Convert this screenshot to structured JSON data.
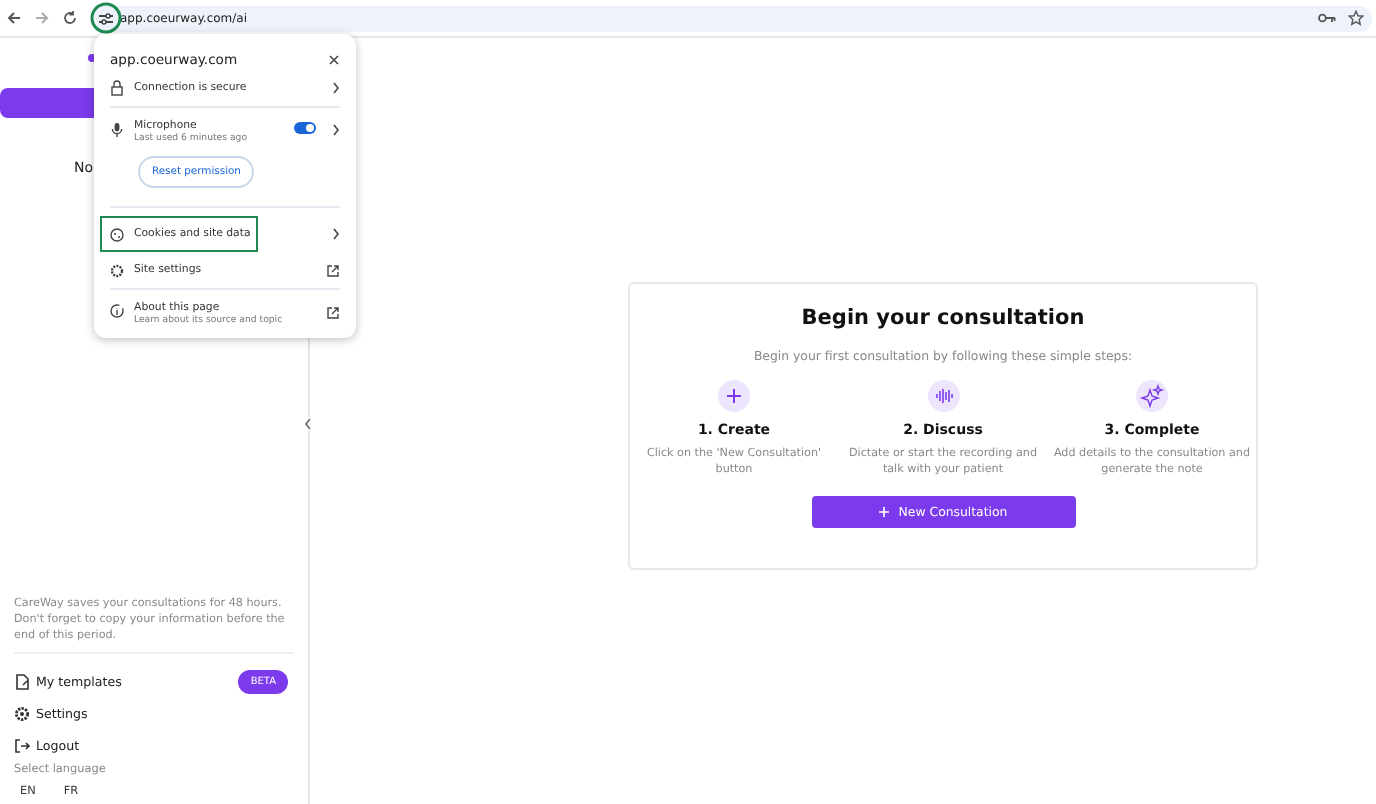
{
  "browser": {
    "url": "app.coeurway.com/ai"
  },
  "site_popup": {
    "site": "app.coeurway.com",
    "connection": "Connection is secure",
    "microphone": {
      "label": "Microphone",
      "detail": "Last used 6 minutes ago",
      "on": true
    },
    "reset_button": "Reset permission",
    "items": [
      {
        "kind": "arrow",
        "label": "Cookies and site data",
        "highlighted": true
      },
      {
        "kind": "external",
        "label": "Site settings",
        "highlighted": false
      }
    ],
    "about": {
      "title": "About this page",
      "detail": "Learn about its source and topic"
    }
  },
  "sidebar": {
    "partial_text": "No",
    "notice": "CareWay saves your consultations for 48 hours. Don't forget to copy your information before the end of this period.",
    "menu": [
      {
        "kind": "templates",
        "label": "My templates",
        "badge": "BETA"
      },
      {
        "kind": "settings",
        "label": "Settings"
      },
      {
        "kind": "logout",
        "label": "Logout"
      }
    ],
    "language_label": "Select language",
    "languages": [
      "EN",
      "FR"
    ]
  },
  "card": {
    "title": "Begin your consultation",
    "subtitle": "Begin your first consultation by following these simple steps:",
    "steps": [
      {
        "kind": "plus",
        "title": "1. Create",
        "text": "Click on the 'New Consultation' button"
      },
      {
        "kind": "wave",
        "title": "2. Discuss",
        "text": "Dictate or start the recording and talk with your patient"
      },
      {
        "kind": "sparkle",
        "title": "3. Complete",
        "text": "Add details to the consultation and generate the note"
      }
    ],
    "button": "New Consultation"
  }
}
